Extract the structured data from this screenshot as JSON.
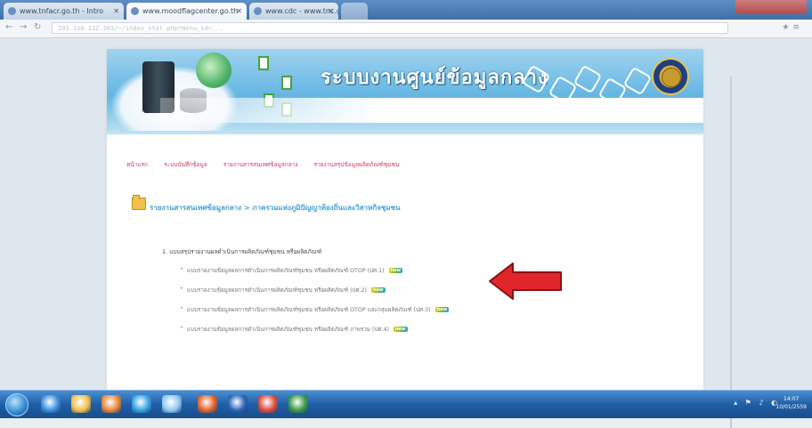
{
  "browser": {
    "tabs": [
      {
        "label": "www.tnfacr.go.th - Intro"
      },
      {
        "label": "www.moodflagcenter.go.th"
      },
      {
        "label": "www.cdc - www.tnc.go.th"
      },
      {
        "label": ""
      }
    ],
    "url": "203.118.112.203/~/index_stat.php?menu_id=..."
  },
  "site": {
    "title": "ระบบงานศูนย์ข้อมูลกลาง"
  },
  "menu": {
    "items": [
      {
        "label": "หน้าแรก"
      },
      {
        "label": "ระบบบันทึกข้อมูล"
      },
      {
        "label": "รายงานสารสนเทศข้อมูลกลาง"
      },
      {
        "label": "รายงานสรุปข้อมูลผลิตภัณฑ์ชุมชน"
      }
    ]
  },
  "section": {
    "title": "รายงานสารสนเทศข้อมูลกลาง > ภาครวมแห่งภูมิปัญญาท้องถิ่นและวิสาหกิจชุมชน"
  },
  "list": {
    "heading": "1. แบบสรุปรายงานผลดำเนินการผลิตภัณฑ์ชุมชน หรือผลิตภัณฑ์",
    "items": [
      {
        "label": "แบบรายงานข้อมูลผลการดำเนินการผลิตภัณฑ์ชุมชน หรือผลิตภัณฑ์ OTOP (ปศ.1)",
        "badge": "new"
      },
      {
        "label": "แบบรายงานข้อมูลผลการดำเนินการผลิตภัณฑ์ชุมชน หรือผลิตภัณฑ์ (ปศ.2)",
        "badge": "new"
      },
      {
        "label": "แบบรายงานข้อมูลผลการดำเนินการผลิตภัณฑ์ชุมชน หรือผลิตภัณฑ์ OTOP และกลุ่มผลิตภัณฑ์ (ปศ.3)",
        "badge": "new"
      },
      {
        "label": "แบบรายงานข้อมูลผลการดำเนินการผลิตภัณฑ์ชุมชน หรือผลิตภัณฑ์ ภาพรวม (ปศ.4)",
        "badge": "new"
      }
    ]
  },
  "annotation": {
    "arrow_color": "#e0262b",
    "arrow_icon": "left-arrow-annotation"
  },
  "taskbar": {
    "apps": [
      {
        "icon": "ie-icon",
        "color": "#3a8fe0"
      },
      {
        "icon": "explorer-icon",
        "color": "#f2c14a"
      },
      {
        "icon": "media-icon",
        "color": "#e8873a"
      },
      {
        "icon": "skype-icon",
        "color": "#36a3e4"
      },
      {
        "icon": "app-icon",
        "color": "#8fc9f0"
      },
      {
        "icon": "firefox-icon",
        "color": "#e2622b"
      },
      {
        "icon": "word-icon",
        "color": "#2b63b8"
      },
      {
        "icon": "chrome-icon",
        "color": "#d94c3d"
      },
      {
        "icon": "excel-icon",
        "color": "#3c9a46"
      }
    ],
    "time": "14:07",
    "date": "10/01/2559"
  }
}
